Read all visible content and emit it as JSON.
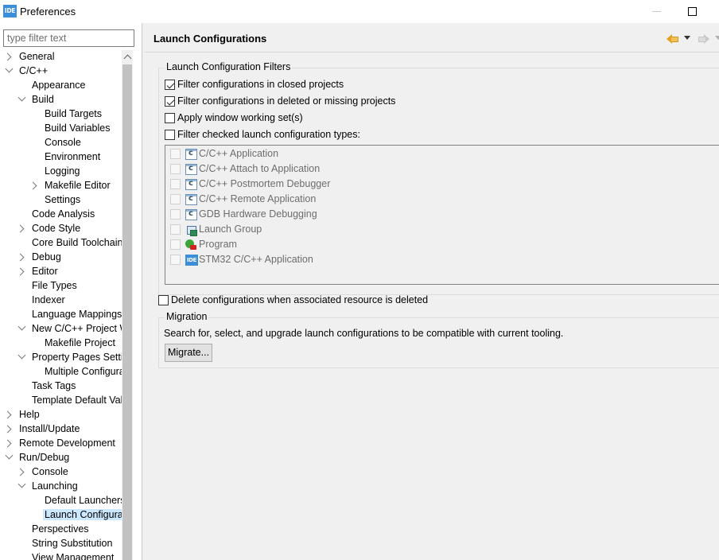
{
  "window": {
    "app_icon_text": "IDE",
    "title": "Preferences"
  },
  "filter": {
    "placeholder": "type filter text",
    "value": ""
  },
  "tree": {
    "items": [
      {
        "label": "General",
        "depth": 0,
        "expander": "collapsed"
      },
      {
        "label": "C/C++",
        "depth": 0,
        "expander": "expanded"
      },
      {
        "label": "Appearance",
        "depth": 1,
        "expander": "none"
      },
      {
        "label": "Build",
        "depth": 1,
        "expander": "expanded"
      },
      {
        "label": "Build Targets",
        "depth": 2,
        "expander": "none"
      },
      {
        "label": "Build Variables",
        "depth": 2,
        "expander": "none"
      },
      {
        "label": "Console",
        "depth": 2,
        "expander": "none"
      },
      {
        "label": "Environment",
        "depth": 2,
        "expander": "none"
      },
      {
        "label": "Logging",
        "depth": 2,
        "expander": "none"
      },
      {
        "label": "Makefile Editor",
        "depth": 2,
        "expander": "collapsed"
      },
      {
        "label": "Settings",
        "depth": 2,
        "expander": "none"
      },
      {
        "label": "Code Analysis",
        "depth": 1,
        "expander": "none"
      },
      {
        "label": "Code Style",
        "depth": 1,
        "expander": "collapsed"
      },
      {
        "label": "Core Build Toolchains",
        "depth": 1,
        "expander": "none"
      },
      {
        "label": "Debug",
        "depth": 1,
        "expander": "collapsed"
      },
      {
        "label": "Editor",
        "depth": 1,
        "expander": "collapsed"
      },
      {
        "label": "File Types",
        "depth": 1,
        "expander": "none"
      },
      {
        "label": "Indexer",
        "depth": 1,
        "expander": "none"
      },
      {
        "label": "Language Mappings",
        "depth": 1,
        "expander": "none"
      },
      {
        "label": "New C/C++ Project Wizard",
        "depth": 1,
        "expander": "expanded"
      },
      {
        "label": "Makefile Project",
        "depth": 2,
        "expander": "none"
      },
      {
        "label": "Property Pages Settings",
        "depth": 1,
        "expander": "expanded"
      },
      {
        "label": "Multiple Configurations Edit",
        "depth": 2,
        "expander": "none"
      },
      {
        "label": "Task Tags",
        "depth": 1,
        "expander": "none"
      },
      {
        "label": "Template Default Values",
        "depth": 1,
        "expander": "none"
      },
      {
        "label": "Help",
        "depth": 0,
        "expander": "collapsed"
      },
      {
        "label": "Install/Update",
        "depth": 0,
        "expander": "collapsed"
      },
      {
        "label": "Remote Development",
        "depth": 0,
        "expander": "collapsed"
      },
      {
        "label": "Run/Debug",
        "depth": 0,
        "expander": "expanded"
      },
      {
        "label": "Console",
        "depth": 1,
        "expander": "collapsed"
      },
      {
        "label": "Launching",
        "depth": 1,
        "expander": "expanded"
      },
      {
        "label": "Default Launchers",
        "depth": 2,
        "expander": "none"
      },
      {
        "label": "Launch Configurations",
        "depth": 2,
        "expander": "none",
        "selected": true
      },
      {
        "label": "Perspectives",
        "depth": 1,
        "expander": "none"
      },
      {
        "label": "String Substitution",
        "depth": 1,
        "expander": "none"
      },
      {
        "label": "View Management",
        "depth": 1,
        "expander": "none"
      }
    ]
  },
  "page": {
    "title": "Launch Configurations"
  },
  "filters_group": {
    "label": "Launch Configuration Filters",
    "options": [
      {
        "label": "Filter configurations in closed projects",
        "checked": true
      },
      {
        "label": "Filter configurations in deleted or missing projects",
        "checked": true
      },
      {
        "label": "Apply window working set(s)",
        "checked": false
      },
      {
        "label": "Filter checked launch configuration types:",
        "checked": false
      }
    ],
    "types": [
      {
        "label": "C/C++ Application",
        "icon": "c-application-icon",
        "checked": false
      },
      {
        "label": "C/C++ Attach to Application",
        "icon": "c-attach-icon",
        "checked": false
      },
      {
        "label": "C/C++ Postmortem Debugger",
        "icon": "c-postmortem-icon",
        "checked": false
      },
      {
        "label": "C/C++ Remote Application",
        "icon": "c-remote-icon",
        "checked": false
      },
      {
        "label": "GDB Hardware Debugging",
        "icon": "c-gdb-hardware-icon",
        "checked": false
      },
      {
        "label": "Launch Group",
        "icon": "launch-group-icon",
        "checked": false
      },
      {
        "label": "Program",
        "icon": "program-icon",
        "checked": false
      },
      {
        "label": "STM32 C/C++ Application",
        "icon": "stm32-ide-icon",
        "checked": false
      }
    ]
  },
  "delete_option": {
    "label": "Delete configurations when associated resource is deleted",
    "checked": false
  },
  "migration": {
    "label": "Migration",
    "description": "Search for, select, and upgrade launch configurations to be compatible with current tooling.",
    "button_label": "Migrate..."
  },
  "colors": {
    "selection": "#cce8ff",
    "pane_background": "#f0f0f0",
    "app_icon": "#3a8fd8"
  }
}
